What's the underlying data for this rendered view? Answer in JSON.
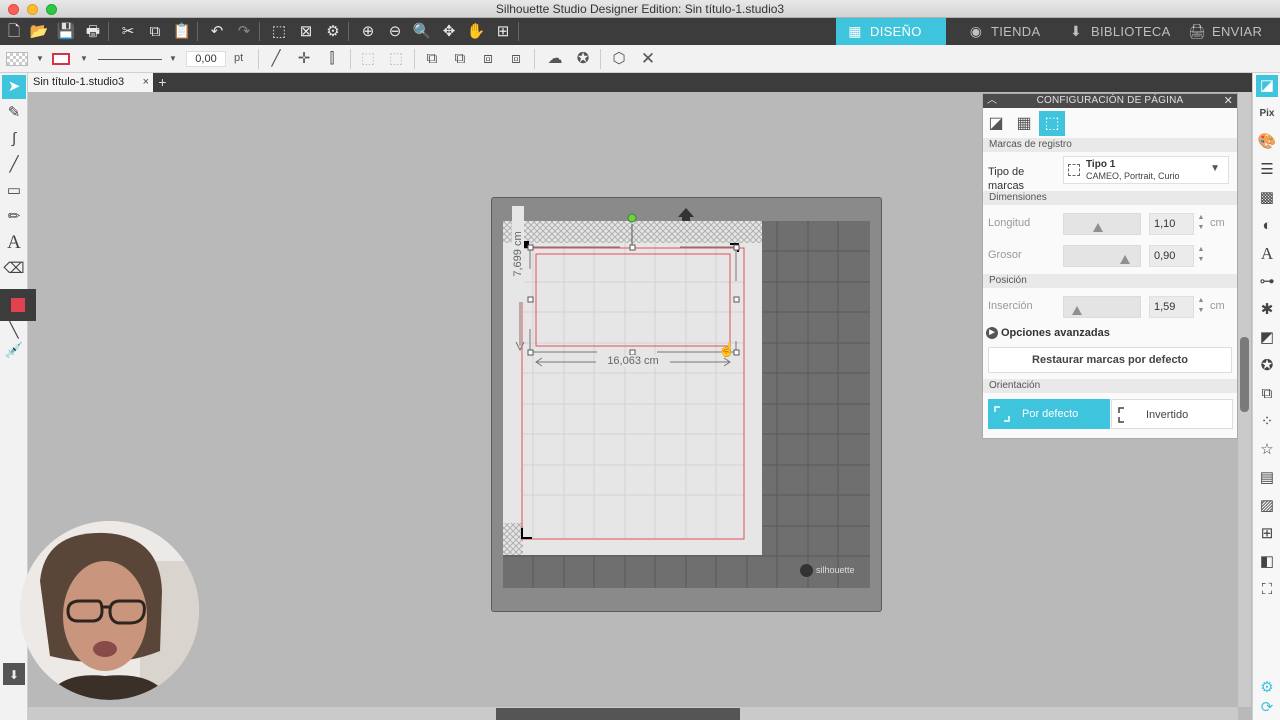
{
  "window": {
    "title": "Silhouette Studio Designer Edition: Sin título-1.studio3"
  },
  "top_tabs": [
    {
      "label": "DISEÑO",
      "active": true
    },
    {
      "label": "TIENDA",
      "active": false
    },
    {
      "label": "BIBLIOTECA",
      "active": false
    },
    {
      "label": "ENVIAR",
      "active": false
    }
  ],
  "toolbar2": {
    "line_width_value": "0,00",
    "line_width_unit": "pt"
  },
  "document_tab": {
    "title": "Sin título-1.studio3",
    "close": "×",
    "add": "+"
  },
  "canvas": {
    "dimension_height": "7,699 cm",
    "dimension_width": "16,063 cm",
    "mat_brand": "silhouette"
  },
  "panel": {
    "title": "CONFIGURACIÓN DE PÁGINA",
    "section_registration": "Marcas de registro",
    "mark_type_label": "Tipo de marcas",
    "mark_type_value": "Tipo 1",
    "mark_type_sub": "CAMEO, Portrait, Curio",
    "section_dimensions": "Dimensiones",
    "length_label": "Longitud",
    "length_value": "1,10",
    "length_unit": "cm",
    "length_level": 0.42,
    "thickness_label": "Grosor",
    "thickness_value": "0,90",
    "thickness_level": 0.85,
    "section_position": "Posición",
    "inset_label": "Inserción",
    "inset_value": "1,59",
    "inset_unit": "cm",
    "inset_level": 0.1,
    "advanced_options": "Opciones avanzadas",
    "restore_button": "Restaurar marcas por defecto",
    "section_orientation": "Orientación",
    "orientation_default": "Por defecto",
    "orientation_inverted": "Invertido"
  },
  "colors": {
    "accent": "#3ec4dd",
    "toolbar_dark": "#3c3c3c",
    "mat_gray": "#8a8a8a",
    "cut_line": "#e0505a"
  }
}
